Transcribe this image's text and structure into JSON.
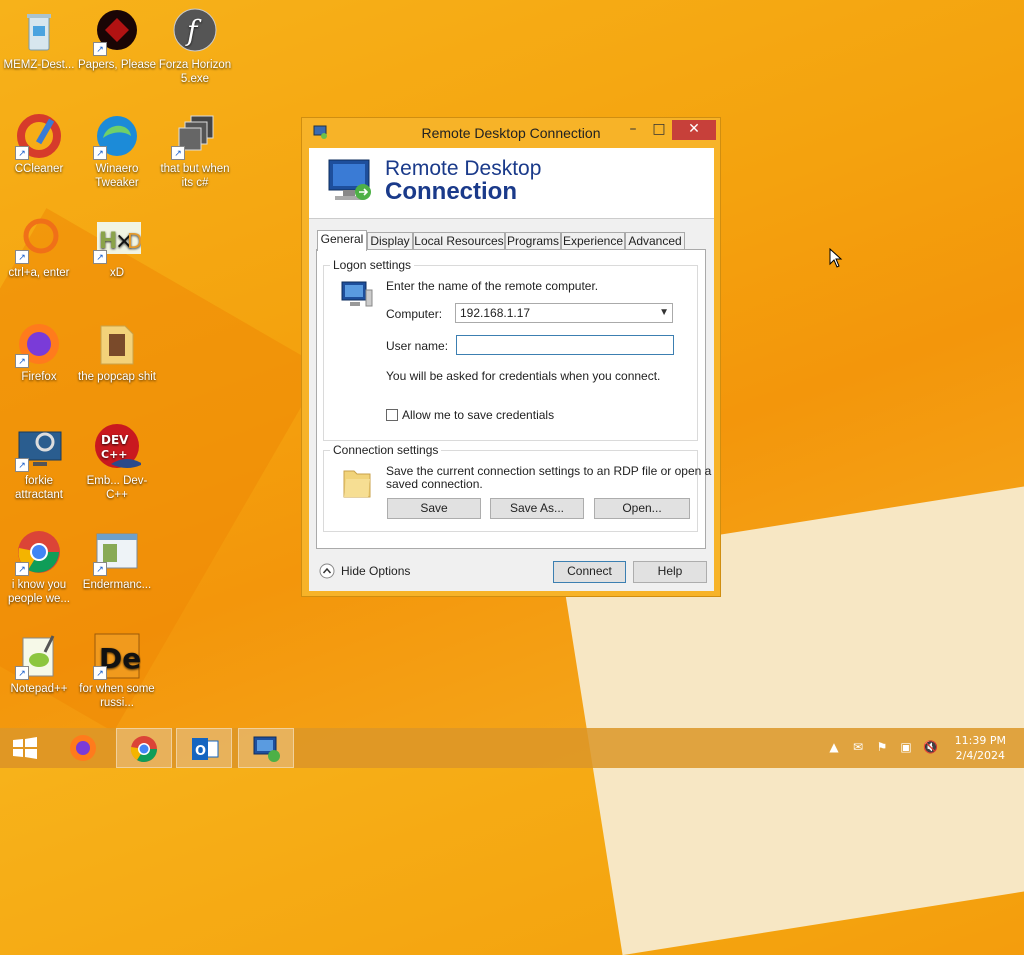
{
  "desktop": {
    "icons": [
      {
        "label": "MEMZ-Dest...",
        "icon": "recycle-bin-icon"
      },
      {
        "label": "Papers, Please",
        "icon": "papers-please-icon"
      },
      {
        "label": "Forza Horizon 5.exe",
        "icon": "flash-icon"
      },
      {
        "label": "CCleaner",
        "icon": "ccleaner-icon"
      },
      {
        "label": "Winaero Tweaker",
        "icon": "winaero-icon"
      },
      {
        "label": "that but when its c#",
        "icon": "stack-icon"
      },
      {
        "label": "ctrl+a, enter",
        "icon": "ring-icon"
      },
      {
        "label": "xD",
        "icon": "hxd-icon"
      },
      {
        "label": "Firefox",
        "icon": "firefox-icon"
      },
      {
        "label": "the popcap shit",
        "icon": "folder-icon"
      },
      {
        "label": "forkie attractant",
        "icon": "monitor-gear-icon"
      },
      {
        "label": "Emb... Dev-C++",
        "icon": "devcpp-icon"
      },
      {
        "label": "i know you people we...",
        "icon": "chrome-icon"
      },
      {
        "label": "Endermanc...",
        "icon": "window-icon"
      },
      {
        "label": "Notepad++",
        "icon": "notepadpp-icon"
      },
      {
        "label": "for when some russi...",
        "icon": "de-icon"
      }
    ]
  },
  "window": {
    "title": "Remote Desktop Connection",
    "banner_line1": "Remote Desktop",
    "banner_line2": "Connection",
    "tabs": [
      "General",
      "Display",
      "Local Resources",
      "Programs",
      "Experience",
      "Advanced"
    ],
    "logon": {
      "heading": "Logon settings",
      "instruction": "Enter the name of the remote computer.",
      "computer_label": "Computer:",
      "computer_value": "192.168.1.17",
      "username_label": "User name:",
      "username_value": "",
      "credentials_note": "You will be asked for credentials when you connect.",
      "save_credentials_label": "Allow me to save credentials"
    },
    "connection": {
      "heading": "Connection settings",
      "description_line1": "Save the current connection settings to an RDP file or open a",
      "description_line2": "saved connection.",
      "save": "Save",
      "save_as": "Save As...",
      "open": "Open..."
    },
    "hide_options": "Hide Options",
    "connect": "Connect",
    "help": "Help"
  },
  "taskbar": {
    "items": [
      "start-icon",
      "firefox-icon",
      "chrome-icon",
      "outlook-icon",
      "remote-desktop-icon"
    ],
    "time": "11:39 PM",
    "date": "2/4/2024"
  }
}
